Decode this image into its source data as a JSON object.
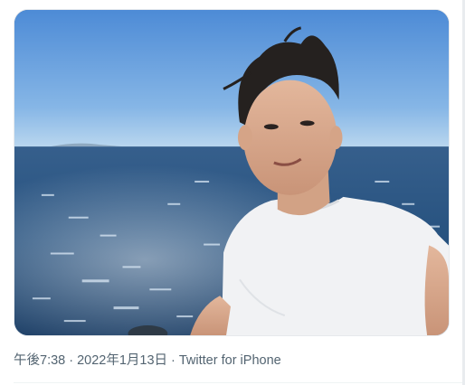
{
  "tweet": {
    "media": {
      "description_icon": "photo-icon"
    },
    "meta": {
      "time": "午後7:38",
      "date": "2022年1月13日",
      "source": "Twitter for iPhone",
      "separator": "·"
    }
  },
  "colors": {
    "meta_text": "#536471",
    "sky_top": "#4f8fd8",
    "sky_horizon": "#b8d6ef",
    "sea": "#28568b",
    "shirt": "#f2f3f5"
  }
}
